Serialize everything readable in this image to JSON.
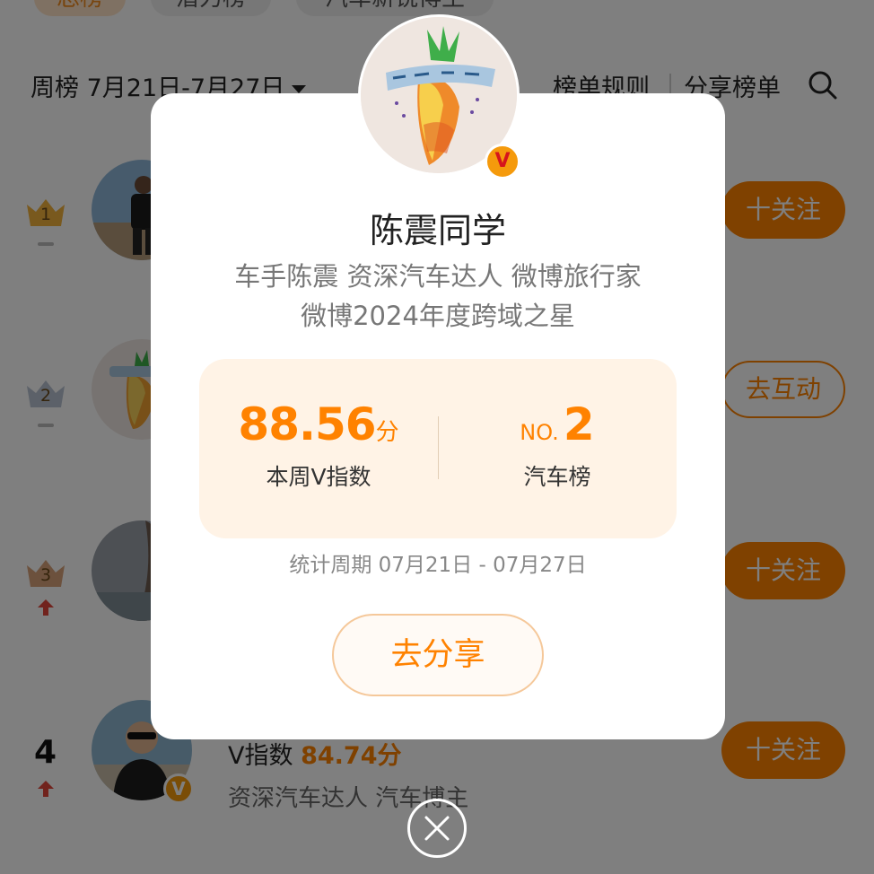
{
  "top_tabs": [
    "总榜",
    "潜力榜",
    "汽车新锐博主"
  ],
  "header": {
    "week_label": "周榜 7月21日-7月27日",
    "rules_label": "榜单规则",
    "share_list_label": "分享榜单",
    "search_icon": "search-icon"
  },
  "ranking": {
    "rows": [
      {
        "rank": "1",
        "trend": "flat",
        "button": "十关注",
        "button_type": "follow"
      },
      {
        "rank": "2",
        "trend": "flat",
        "button": "去互动",
        "button_type": "interact"
      },
      {
        "rank": "3",
        "trend": "up",
        "button": "十关注",
        "button_type": "follow"
      },
      {
        "rank": "4",
        "trend": "up",
        "button": "十关注",
        "button_type": "follow",
        "vi_prefix": "V指数",
        "vi_value": "84.74分",
        "desc": "资深汽车达人 汽车博主"
      }
    ]
  },
  "modal": {
    "name": "陈震同学",
    "bio_line1": "车手陈震 资深汽车达人 微博旅行家",
    "bio_line2": "微博2024年度跨域之星",
    "badge": "V",
    "score_value": "88.56",
    "score_unit": "分",
    "score_label": "本周V指数",
    "rank_prefix": "NO.",
    "rank_value": "2",
    "rank_label": "汽车榜",
    "period": "统计周期 07月21日 - 07月27日",
    "share_button": "去分享"
  },
  "colors": {
    "accent": "#ff8200",
    "card_bg": "#fff3e6",
    "overlay": "rgba(0,0,0,0.5)"
  }
}
